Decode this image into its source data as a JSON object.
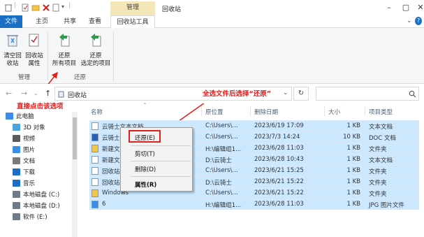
{
  "window": {
    "title": "回收站",
    "ribbon_context_group": "管理"
  },
  "tabs": [
    "文件",
    "主页",
    "共享",
    "查看",
    "回收站工具"
  ],
  "ribbon": {
    "groups": [
      {
        "label": "管理",
        "buttons": [
          {
            "line1": "清空回",
            "line2": "收站"
          },
          {
            "line1": "回收站",
            "line2": "属性"
          }
        ]
      },
      {
        "label": "还原",
        "buttons": [
          {
            "line1": "还原",
            "line2": "所有项目"
          },
          {
            "line1": "还原",
            "line2": "选定的项目"
          }
        ]
      }
    ]
  },
  "address": {
    "path": "回收站",
    "refresh_icon": "↻"
  },
  "annotations": {
    "top": "全选文件后选择“还原”",
    "left": "直接点击该选项"
  },
  "nav_pane": [
    {
      "label": "此电脑",
      "icon": "pc-icon",
      "color": "#3a8ee6",
      "indent": 0
    },
    {
      "label": "3D 对象",
      "icon": "3d-objects-icon",
      "color": "#4aa3df",
      "indent": 1
    },
    {
      "label": "视频",
      "icon": "video-icon",
      "color": "#5a5a5a",
      "indent": 1
    },
    {
      "label": "图片",
      "icon": "pictures-icon",
      "color": "#3a8ee6",
      "indent": 1
    },
    {
      "label": "文档",
      "icon": "documents-icon",
      "color": "#7a7a7a",
      "indent": 1
    },
    {
      "label": "下载",
      "icon": "downloads-icon",
      "color": "#1a6fc3",
      "indent": 1
    },
    {
      "label": "音乐",
      "icon": "music-icon",
      "color": "#1a6fc3",
      "indent": 1
    },
    {
      "label": "本地磁盘 (C:)",
      "icon": "drive-icon",
      "color": "#6e7a88",
      "indent": 1
    },
    {
      "label": "本地磁盘 (D:)",
      "icon": "drive-icon",
      "color": "#6e7a88",
      "indent": 1
    },
    {
      "label": "软件 (E:)",
      "icon": "drive-icon",
      "color": "#6e7a88",
      "indent": 1
    }
  ],
  "columns": [
    "名称",
    "原位置",
    "删除日期",
    "大小",
    "项目类型"
  ],
  "files": [
    {
      "name": "云骑士文本文档",
      "location": "C:\\Users\\...",
      "date": "2023/6/19 17:09",
      "size": "1 KB",
      "type": "文本文档",
      "icon": "text-file-icon"
    },
    {
      "name": "云骑士...",
      "location": "C:\\Users\\...",
      "date": "2023/7/3 14:24",
      "size": "10 KB",
      "type": "DOC 文档",
      "icon": "word-file-icon"
    },
    {
      "name": "新建文...",
      "location": "H:\\编辑组1...",
      "date": "2023/6/28 11:03",
      "size": "1 KB",
      "type": "文件夹",
      "icon": "folder-icon"
    },
    {
      "name": "新建文...",
      "location": "D:\\云骑士",
      "date": "2023/6/28 10:43",
      "size": "1 KB",
      "type": "文本文档",
      "icon": "text-file-icon"
    },
    {
      "name": "回收站...",
      "location": "C:\\Users\\...",
      "date": "2023/6/21 15:25",
      "size": "1 KB",
      "type": "文件夹",
      "icon": "text-file-icon"
    },
    {
      "name": "回收站...",
      "location": "D:\\云骑士",
      "date": "2023/6/21 15:22",
      "size": "1 KB",
      "type": "文件夹",
      "icon": "text-file-icon"
    },
    {
      "name": "Windows",
      "location": "C:\\Users\\...",
      "date": "2023/6/21 15:22",
      "size": "1 KB",
      "type": "文件夹",
      "icon": "folder-icon"
    },
    {
      "name": "6",
      "location": "H:\\编辑组1...",
      "date": "2023/6/28 11:03",
      "size": "1 KB",
      "type": "JPG 图片文件",
      "icon": "image-file-icon"
    }
  ],
  "context_menu": [
    {
      "label": "还原(E)"
    },
    {
      "label": "剪切(T)"
    },
    {
      "label": "删除(D)"
    },
    {
      "label": "属性(R)",
      "bold": true
    }
  ],
  "colors": {
    "accent": "#1a6fc3",
    "selection": "#cce8ff",
    "annotation": "#e02020",
    "manage_tab": "#f4e6b6"
  }
}
